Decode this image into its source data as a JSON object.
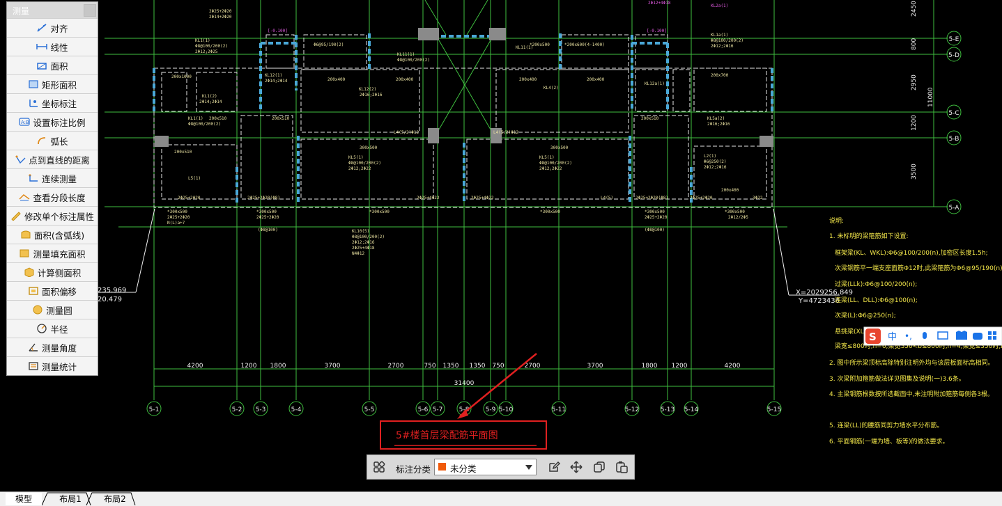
{
  "panel": {
    "title": "测量",
    "items": [
      {
        "label": "对齐",
        "icon": "align-measure-icon"
      },
      {
        "label": "线性",
        "icon": "linear-measure-icon"
      },
      {
        "label": "面积",
        "icon": "area-icon"
      },
      {
        "label": "矩形面积",
        "icon": "rect-area-icon"
      },
      {
        "label": "坐标标注",
        "icon": "coordinate-icon"
      },
      {
        "label": "设置标注比例",
        "icon": "scale-setting-icon"
      },
      {
        "label": "弧长",
        "icon": "arc-length-icon"
      },
      {
        "label": "点到直线的距离",
        "icon": "point-line-distance-icon"
      },
      {
        "label": "连续测量",
        "icon": "continuous-measure-icon"
      },
      {
        "label": "查看分段长度",
        "icon": "segment-length-icon"
      },
      {
        "label": "修改单个标注属性",
        "icon": "edit-annotation-icon"
      },
      {
        "label": "面积(含弧线)",
        "icon": "arc-area-icon"
      },
      {
        "label": "测量填充面积",
        "icon": "fill-area-icon"
      },
      {
        "label": "计算侧面积",
        "icon": "side-area-icon"
      },
      {
        "label": "面积偏移",
        "icon": "area-offset-icon"
      },
      {
        "label": "测量圆",
        "icon": "circle-measure-icon"
      },
      {
        "label": "半径",
        "icon": "radius-icon"
      },
      {
        "label": "测量角度",
        "icon": "angle-icon"
      },
      {
        "label": "测量统计",
        "icon": "statistics-icon"
      }
    ]
  },
  "toolbar": {
    "category_label": "标注分类",
    "category_value": "未分类",
    "category_color": "#f05a0a"
  },
  "tabs": [
    "模型",
    "布局1",
    "布局2"
  ],
  "drawing": {
    "title": "5#楼首层梁配筋平面图",
    "axes_bottom": [
      "5-1",
      "5-2",
      "5-3",
      "5-4",
      "5-5",
      "5-6",
      "5-7",
      "5-8",
      "5-9",
      "5-10",
      "5-11",
      "5-12",
      "5-13",
      "5-14",
      "5-15"
    ],
    "axes_right": [
      "5-E",
      "5-D",
      "5-C",
      "5-B",
      "5-A"
    ],
    "dims_bottom": [
      "4200",
      "1200",
      "1800",
      "3700",
      "2700",
      "750",
      "1350",
      "1350",
      "750",
      "2700",
      "3700",
      "1800",
      "1200",
      "4200"
    ],
    "dim_total": "31400",
    "dims_right": [
      "2450",
      "800",
      "2950",
      "11000",
      "1200",
      "3500"
    ],
    "coord_left": [
      "235.969",
      "20.479"
    ],
    "coord_right": [
      "X=2029256.849",
      "Y=4723436"
    ],
    "notes": [
      "说明:",
      "1. 未标明的梁箍筋如下设置:",
      "框架梁(KL、WKL):Φ6@100/200(n),加密区长度1.5h;",
      "次梁钢筋平一端支座面筋Φ12时,此梁箍筋为Φ6@95/190(n)。",
      "过梁(LLk):Φ6@100/200(n);",
      "连梁(LL、DLL):Φ6@100(n);",
      "次梁(L):Φ6@250(n);",
      "悬挑梁(XL):",
      "梁宽≤800时,n=6;梁宽350<b≤800时,n=4;梁宽≤350时,n=2;",
      "2. 图中所示梁顶标高除特别注明外均与该层板面标高相同。",
      "3. 次梁附加箍筋做法详见图集及说明(一)3.6条。",
      "4. 主梁钢筋根数按所选截面中,未注明附加箍筋每侧各3根。",
      "5. 连梁(LL)的腰筋同剪力墙水平分布筋。",
      "6. 平面钢筋(一端为墙、板等)的做法要求。"
    ]
  }
}
